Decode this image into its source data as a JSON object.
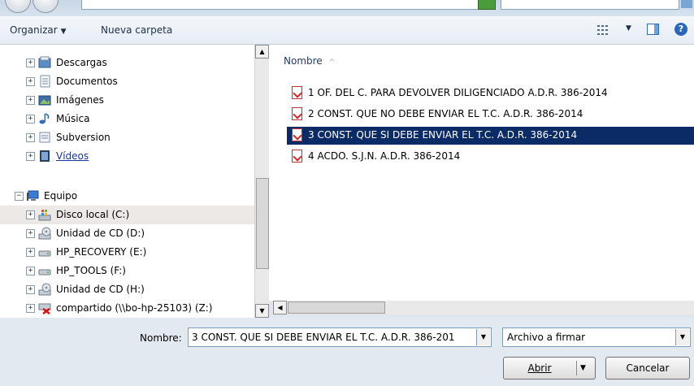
{
  "toolbar": {
    "organize_label": "Organizar",
    "new_folder_label": "Nueva carpeta"
  },
  "nav_tree": {
    "libraries": [
      {
        "label": "Descargas",
        "icon": "downloads-icon"
      },
      {
        "label": "Documentos",
        "icon": "documents-icon"
      },
      {
        "label": "Imágenes",
        "icon": "pictures-icon"
      },
      {
        "label": "Música",
        "icon": "music-icon"
      },
      {
        "label": "Subversion",
        "icon": "subversion-icon"
      },
      {
        "label": "Vídeos",
        "icon": "videos-icon"
      }
    ],
    "computer_label": "Equipo",
    "drives": [
      {
        "label": "Disco local (C:)",
        "icon": "local-disk-icon"
      },
      {
        "label": "Unidad de CD (D:)",
        "icon": "cd-drive-icon"
      },
      {
        "label": "HP_RECOVERY (E:)",
        "icon": "drive-icon"
      },
      {
        "label": "HP_TOOLS (F:)",
        "icon": "drive-icon"
      },
      {
        "label": "Unidad de CD (H:)",
        "icon": "cd-drive-icon"
      },
      {
        "label": "compartido (\\\\bo-hp-25103) (Z:)",
        "icon": "network-drive-disconnected-icon"
      }
    ]
  },
  "file_list": {
    "column_header": "Nombre",
    "files": [
      {
        "name": "1 OF. DEL C. PARA DEVOLVER DILIGENCIADO A.D.R. 386-2014"
      },
      {
        "name": "2 CONST. QUE NO DEBE ENVIAR EL T.C. A.D.R. 386-2014"
      },
      {
        "name": "3 CONST. QUE SI DEBE ENVIAR EL T.C. A.D.R. 386-2014"
      },
      {
        "name": "4 ACDO. S.J.N. A.D.R. 386-2014"
      }
    ],
    "selected_index": 2
  },
  "bottom": {
    "name_label": "Nombre:",
    "name_value": "3 CONST. QUE SI DEBE ENVIAR EL T.C. A.D.R. 386-201",
    "filter_value": "Archivo a firmar",
    "open_label": "Abrir",
    "cancel_label": "Cancelar"
  },
  "colors": {
    "selection": "#0b2b66",
    "hover_row": "#ece9e6",
    "link": "#1a36a8"
  }
}
